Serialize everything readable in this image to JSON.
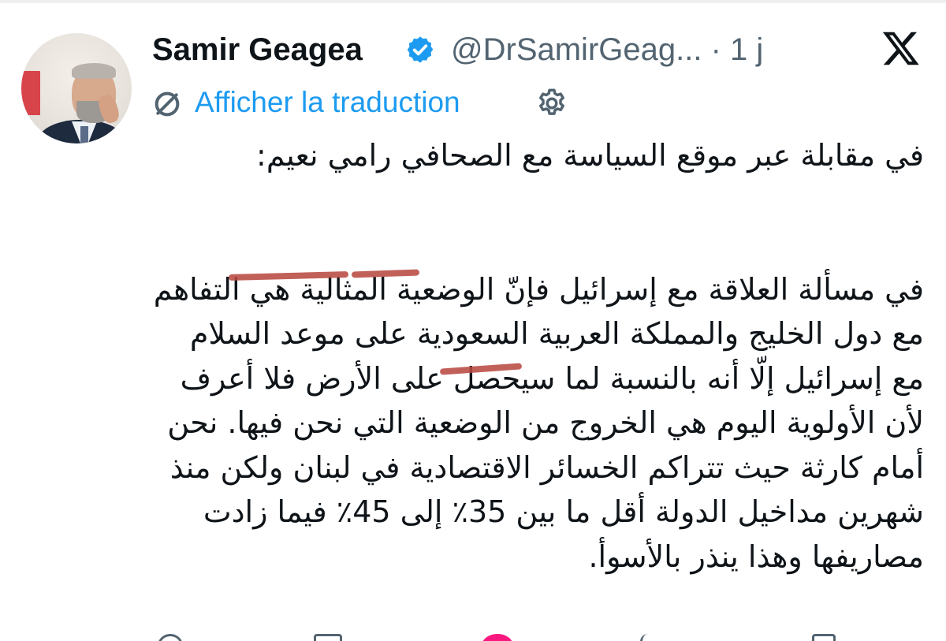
{
  "tweet": {
    "author_name": "Samir Geagea",
    "handle": "@DrSamirGeag...",
    "separator": "·",
    "time": "1 j",
    "translate_label": "Afficher la traduction",
    "paragraph1": "في مقابلة عبر موقع السياسة مع الصحافي رامي نعيم:",
    "paragraph2": "في مسألة العلاقة مع إسرائيل فإنّ الوضعية المثالية هي التفاهم مع دول الخليج والمملكة العربية السعودية على موعد السلام مع إسرائيل إلّا أنه بالنسبة لما سيحصل على الأرض فلا أعرف لأن الأولوية اليوم هي الخروج من الوضعية التي نحن فيها. نحن أمام كارثة حيث تتراكم الخسائر الاقتصادية في لبنان ولكن منذ شهرين مداخيل الدولة أقل ما بين 35٪ إلى 45٪ فيما زادت مصاريفها وهذا ينذر بالأسوأ."
  },
  "icons": {
    "verified": "verified-badge-icon",
    "logo": "x-logo-icon",
    "translate": "translate-icon",
    "settings": "gear-icon",
    "reply": "reply-icon",
    "repost": "repost-icon",
    "like": "like-icon",
    "views": "views-icon",
    "bookmark": "bookmark-icon"
  },
  "colors": {
    "accent": "#1d9bf0",
    "text": "#0f1419",
    "muted": "#536471",
    "like": "#f91880",
    "annotation": "#b84a42"
  }
}
